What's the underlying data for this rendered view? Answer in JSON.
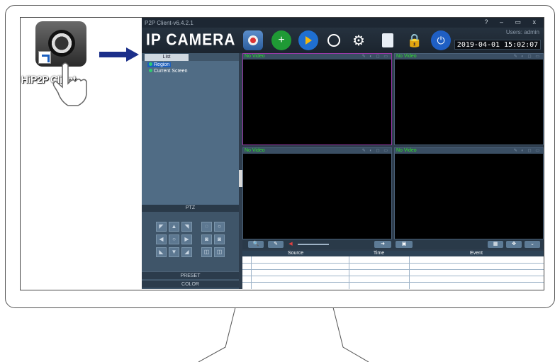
{
  "desktop": {
    "icon_label": "HiP2P Client",
    "icon_name": "camera-app-icon"
  },
  "app": {
    "window_title": "P2P Client-v6.4.2.1",
    "brand": "IP CAMERA",
    "users_text": "Users: admin",
    "datetime": "2019-04-01  15:02:07",
    "window_controls": "? – ▭ x",
    "toolbar_icons": [
      "camera-icon",
      "add-icon",
      "play-icon",
      "ptz-icon",
      "settings-icon",
      "record-icon",
      "lock-icon",
      "power-icon"
    ]
  },
  "left_panel": {
    "tab_label": "List",
    "tree": [
      "Region",
      "Current Screen"
    ],
    "ptz_label": "PTZ",
    "preset_label": "PRESET",
    "color_label": "COLOR"
  },
  "video": {
    "cells": [
      "No Video",
      "No Video",
      "No Video",
      "No Video"
    ]
  },
  "events": {
    "columns": [
      "Source",
      "Time",
      "Event"
    ]
  },
  "colors": {
    "accent": "#1c5fbf",
    "status_green": "#2ee02e",
    "selected_border": "#9a3aa8"
  }
}
